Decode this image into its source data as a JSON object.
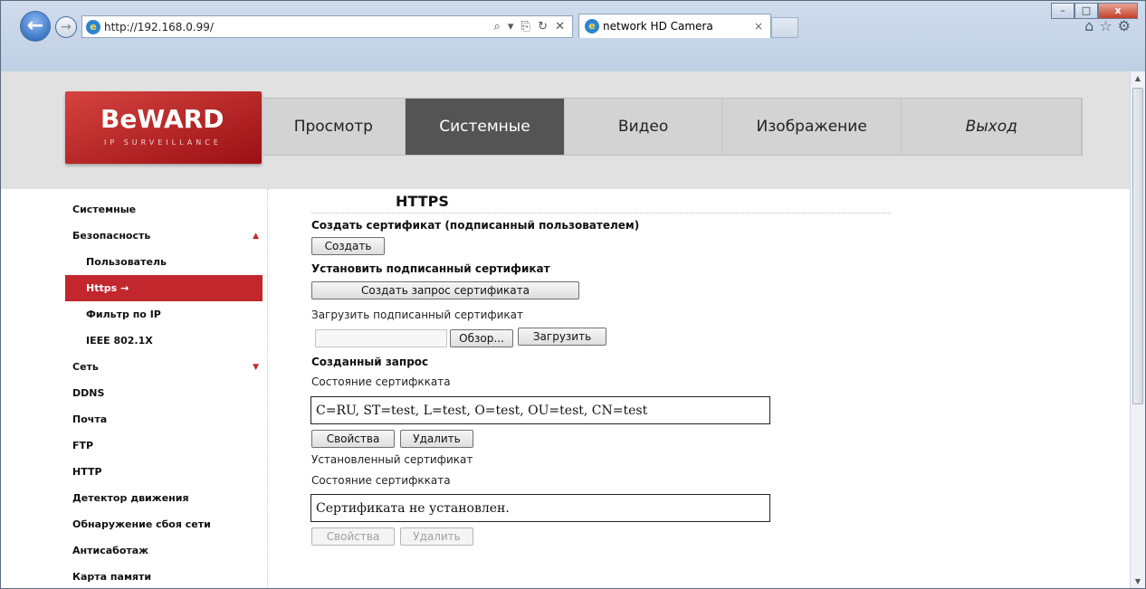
{
  "browser": {
    "url": "http://192.168.0.99/",
    "address_tools": "⌕ ▾ ⎘ ↻ ✕",
    "tab_title": "network HD Camera",
    "tab_close": "×",
    "minimize": "–",
    "maximize": "□",
    "close": "x",
    "back": "←",
    "forward": "→",
    "ie_glyph": "e",
    "home_icon": "⌂",
    "favorites_icon": "☆",
    "tools_icon": "⚙"
  },
  "header": {
    "logo_text": "BeWARD",
    "logo_subtext": "IP SURVEILLANCE",
    "nav": [
      {
        "label": "Просмотр",
        "active": false
      },
      {
        "label": "Системные",
        "active": true
      },
      {
        "label": "Видео",
        "active": false
      },
      {
        "label": "Изображение",
        "active": false
      },
      {
        "label": "Выход",
        "active": false
      }
    ]
  },
  "sidebar": {
    "items": [
      {
        "label": "Системные"
      },
      {
        "label": "Безопасность",
        "marker": "▲"
      },
      {
        "label": "Пользователь"
      },
      {
        "label": "Https",
        "active": true,
        "arrow": "→"
      },
      {
        "label": "Фильтр по IP"
      },
      {
        "label": "IEEE 802.1X"
      },
      {
        "label": "Сеть",
        "marker": "▼"
      },
      {
        "label": "DDNS"
      },
      {
        "label": "Почта"
      },
      {
        "label": "FTP"
      },
      {
        "label": "HTTP"
      },
      {
        "label": "Детектор движения"
      },
      {
        "label": "Обнаружение сбоя сети"
      },
      {
        "label": "Антисаботаж"
      },
      {
        "label": "Карта памяти"
      }
    ]
  },
  "main": {
    "title": "HTTPS",
    "create_cert_heading": "Создать сертификат (подписанный пользователем)",
    "create_button": "Создать",
    "install_signed_heading": "Установить подписанный сертификат",
    "create_request_button": "Создать запрос сертификата",
    "upload_signed_label": "Загрузить подписанный сертификат",
    "browse_button": "Обзор...",
    "upload_button": "Загрузить",
    "created_request_heading": "Созданный запрос",
    "cert_status_label": "Состояние сертифкката",
    "request_status_value": "C=RU, ST=test, L=test, O=test, OU=test, CN=test",
    "properties_button": "Свойства",
    "delete_button": "Удалить",
    "installed_cert_label": "Установленный сертификат",
    "installed_status_label": "Состояние сертифкката",
    "installed_status_value": "Сертификата не установлен.",
    "installed_properties_button": "Свойства",
    "installed_delete_button": "Удалить"
  }
}
